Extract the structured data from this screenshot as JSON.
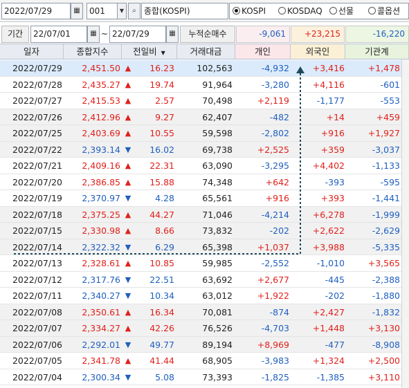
{
  "toolbar": {
    "date": "2022/07/29",
    "code": "001",
    "name": "종합(KOSPI)",
    "radios": [
      {
        "label": "KOSPI",
        "checked": true
      },
      {
        "label": "KOSDAQ",
        "checked": false
      },
      {
        "label": "선물",
        "checked": false
      },
      {
        "label": "콜옵션",
        "checked": false
      }
    ]
  },
  "period": {
    "label": "기간",
    "start": "22/07/01",
    "sep": "~",
    "end": "22/07/29",
    "cum_label": "누적순매수",
    "cum_individual": "-9,061",
    "cum_foreign": "+23,215",
    "cum_institution": "-16,220"
  },
  "colors": {
    "up": "#e0201b",
    "down": "#1f5fbf"
  },
  "columns": [
    "일자",
    "종합지수",
    "전일비",
    "거래대금",
    "개인",
    "외국인",
    "기관계"
  ],
  "rows": [
    {
      "date": "2022/07/29",
      "index": "2,451.50",
      "dir": "up",
      "change": "16.23",
      "volume": "102,563",
      "individual": "-4,932",
      "foreign": "+3,416",
      "institution": "+1,478"
    },
    {
      "date": "2022/07/28",
      "index": "2,435.27",
      "dir": "up",
      "change": "19.74",
      "volume": "91,964",
      "individual": "-3,280",
      "foreign": "+4,116",
      "institution": "-601"
    },
    {
      "date": "2022/07/27",
      "index": "2,415.53",
      "dir": "up",
      "change": "2.57",
      "volume": "70,498",
      "individual": "+2,119",
      "foreign": "-1,177",
      "institution": "-553"
    },
    {
      "date": "2022/07/26",
      "index": "2,412.96",
      "dir": "up",
      "change": "9.27",
      "volume": "62,407",
      "individual": "-482",
      "foreign": "+14",
      "institution": "+459"
    },
    {
      "date": "2022/07/25",
      "index": "2,403.69",
      "dir": "up",
      "change": "10.55",
      "volume": "59,598",
      "individual": "-2,802",
      "foreign": "+916",
      "institution": "+1,927"
    },
    {
      "date": "2022/07/22",
      "index": "2,393.14",
      "dir": "down",
      "change": "16.02",
      "volume": "69,738",
      "individual": "+2,525",
      "foreign": "+359",
      "institution": "-3,037"
    },
    {
      "date": "2022/07/21",
      "index": "2,409.16",
      "dir": "up",
      "change": "22.31",
      "volume": "63,090",
      "individual": "-3,295",
      "foreign": "+4,402",
      "institution": "-1,133"
    },
    {
      "date": "2022/07/20",
      "index": "2,386.85",
      "dir": "up",
      "change": "15.88",
      "volume": "74,348",
      "individual": "+642",
      "foreign": "-393",
      "institution": "-595"
    },
    {
      "date": "2022/07/19",
      "index": "2,370.97",
      "dir": "down",
      "change": "4.28",
      "volume": "65,561",
      "individual": "+916",
      "foreign": "+393",
      "institution": "-1,441"
    },
    {
      "date": "2022/07/18",
      "index": "2,375.25",
      "dir": "up",
      "change": "44.27",
      "volume": "71,046",
      "individual": "-4,214",
      "foreign": "+6,278",
      "institution": "-1,999"
    },
    {
      "date": "2022/07/15",
      "index": "2,330.98",
      "dir": "up",
      "change": "8.66",
      "volume": "73,832",
      "individual": "-202",
      "foreign": "+2,622",
      "institution": "-2,629"
    },
    {
      "date": "2022/07/14",
      "index": "2,322.32",
      "dir": "down",
      "change": "6.29",
      "volume": "65,398",
      "individual": "+1,037",
      "foreign": "+3,988",
      "institution": "-5,335"
    },
    {
      "date": "2022/07/13",
      "index": "2,328.61",
      "dir": "up",
      "change": "10.85",
      "volume": "59,985",
      "individual": "-2,552",
      "foreign": "-1,010",
      "institution": "+3,565"
    },
    {
      "date": "2022/07/12",
      "index": "2,317.76",
      "dir": "down",
      "change": "22.51",
      "volume": "63,692",
      "individual": "+2,677",
      "foreign": "-445",
      "institution": "-2,388"
    },
    {
      "date": "2022/07/11",
      "index": "2,340.27",
      "dir": "down",
      "change": "10.34",
      "volume": "63,012",
      "individual": "+1,922",
      "foreign": "-202",
      "institution": "-1,880"
    },
    {
      "date": "2022/07/08",
      "index": "2,350.61",
      "dir": "up",
      "change": "16.34",
      "volume": "70,081",
      "individual": "-874",
      "foreign": "+2,427",
      "institution": "-1,832"
    },
    {
      "date": "2022/07/07",
      "index": "2,334.27",
      "dir": "up",
      "change": "42.26",
      "volume": "76,526",
      "individual": "-4,703",
      "foreign": "+1,448",
      "institution": "+3,130"
    },
    {
      "date": "2022/07/06",
      "index": "2,292.01",
      "dir": "down",
      "change": "49.77",
      "volume": "89,194",
      "individual": "+8,969",
      "foreign": "-477",
      "institution": "-8,908"
    },
    {
      "date": "2022/07/05",
      "index": "2,341.78",
      "dir": "up",
      "change": "41.44",
      "volume": "68,905",
      "individual": "-3,983",
      "foreign": "+1,324",
      "institution": "+2,500"
    },
    {
      "date": "2022/07/04",
      "index": "2,300.34",
      "dir": "down",
      "change": "5.08",
      "volume": "73,393",
      "individual": "-1,825",
      "foreign": "-1,385",
      "institution": "+3,110"
    }
  ]
}
